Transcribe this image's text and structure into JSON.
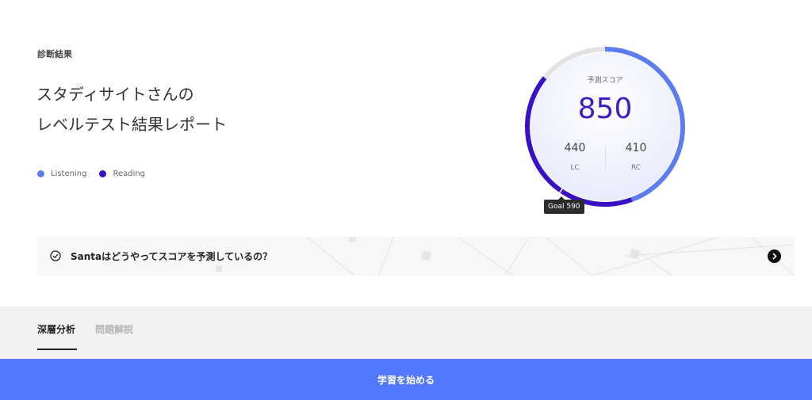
{
  "header": {
    "section_label": "診断結果",
    "title_line1": "スタディサイトさんの",
    "title_line2": "レベルテスト結果レポート"
  },
  "legend": {
    "items": [
      {
        "label": "Listening",
        "color": "#5b7df0"
      },
      {
        "label": "Reading",
        "color": "#3a0fc6"
      }
    ]
  },
  "gauge": {
    "label": "予測スコア",
    "score": "850",
    "lc_value": "440",
    "lc_label": "LC",
    "rc_value": "410",
    "rc_label": "RC",
    "goal_label": "Goal 590",
    "max_score": 990,
    "listening_score": 440,
    "reading_score": 410,
    "goal_score": 590,
    "listening_color": "#5b7df0",
    "reading_color": "#3a0fc6",
    "track_color": "#e2e2e2"
  },
  "banner": {
    "text": "Santaはどうやってスコアを予測しているの？"
  },
  "tabs": [
    {
      "label": "深層分析",
      "active": true
    },
    {
      "label": "問題解説",
      "active": false
    }
  ],
  "cta": {
    "label": "学習を始める",
    "color": "#5278ff"
  }
}
